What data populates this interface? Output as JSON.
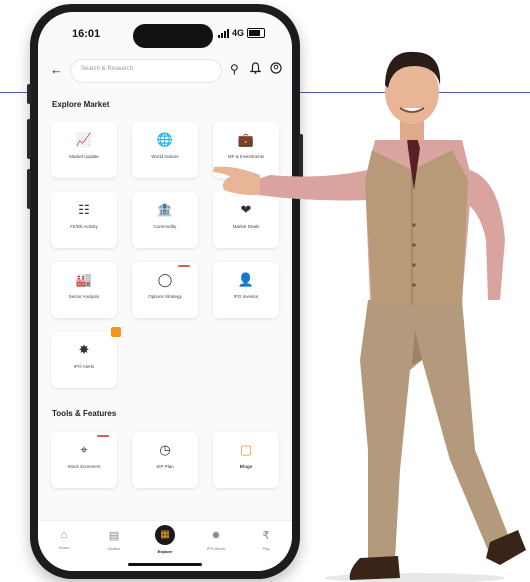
{
  "status": {
    "time": "16:01",
    "network": "4G"
  },
  "search": {
    "placeholder": "Search & Research"
  },
  "sections": {
    "explore_market": "Explore Market",
    "tools_features": "Tools & Features"
  },
  "explore_cards": [
    {
      "label": "Market Update",
      "icon": "chart-icon"
    },
    {
      "label": "World Indices",
      "icon": "globe-icon"
    },
    {
      "label": "MF & Investments",
      "icon": "bag-icon"
    },
    {
      "label": "FII/DII Activity",
      "icon": "pillars-icon"
    },
    {
      "label": "Commodity",
      "icon": "bank-icon"
    },
    {
      "label": "Market Deals",
      "icon": "handshake-icon"
    },
    {
      "label": "Sector Analysis",
      "icon": "factory-icon"
    },
    {
      "label": "Options Strategy",
      "icon": "target-icon"
    },
    {
      "label": "IPO Investor",
      "icon": "person-icon"
    },
    {
      "label": "IPO Alerts",
      "icon": "bulb-icon"
    }
  ],
  "tools_cards": [
    {
      "label": "Stock Screeners",
      "icon": "scan-icon"
    },
    {
      "label": "SIP Plan",
      "icon": "timer-icon"
    },
    {
      "label": "Blogs",
      "icon": "note-icon"
    }
  ],
  "nav": [
    {
      "label": "Home",
      "icon": "home-icon"
    },
    {
      "label": "Orders",
      "icon": "bars-icon"
    },
    {
      "label": "Explore",
      "icon": "explore-icon"
    },
    {
      "label": "IPO Alerts",
      "icon": "bulb-icon"
    },
    {
      "label": "Pay",
      "icon": "pay-icon"
    }
  ],
  "colors": {
    "accent": "#f7941d",
    "badge": "#e05a4f",
    "rule": "#4a5bb5"
  }
}
